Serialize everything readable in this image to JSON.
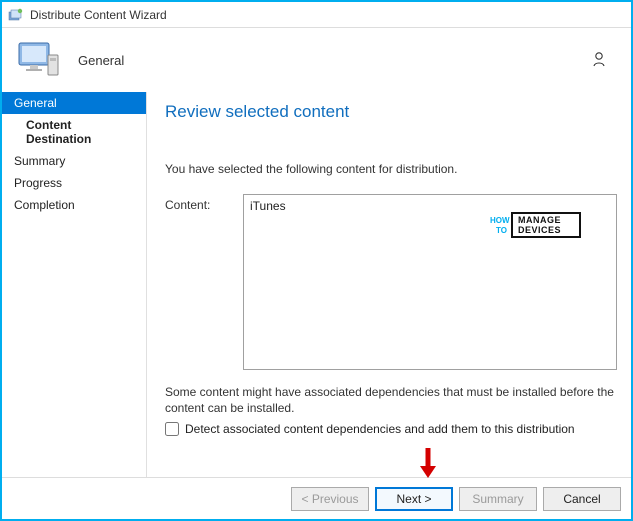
{
  "window": {
    "title": "Distribute Content Wizard"
  },
  "header": {
    "title": "General"
  },
  "sidebar": {
    "items": [
      {
        "label": "General",
        "active": true
      },
      {
        "label": "Content Destination",
        "sub": true
      },
      {
        "label": "Summary"
      },
      {
        "label": "Progress"
      },
      {
        "label": "Completion"
      }
    ]
  },
  "main": {
    "page_title": "Review selected content",
    "intro": "You have selected the following content for distribution.",
    "content_label": "Content:",
    "content_items": [
      "iTunes"
    ],
    "hint": "Some content might have associated dependencies that must be installed before the content can be installed.",
    "checkbox_label": "Detect associated content dependencies and add them to this distribution"
  },
  "footer": {
    "previous": "< Previous",
    "next": "Next >",
    "summary": "Summary",
    "cancel": "Cancel"
  },
  "watermark": {
    "how": "HOW",
    "to": "TO",
    "manage": "MANAGE",
    "devices": "DEVICES"
  }
}
